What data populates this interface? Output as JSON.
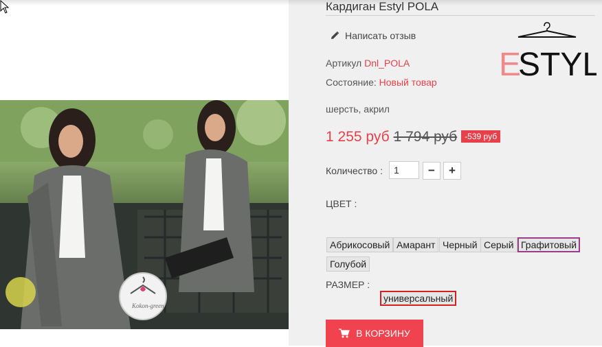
{
  "product": {
    "title": "Кардиган Estyl POLA",
    "review_link": "Написать отзыв",
    "sku_label": "Артикул",
    "sku_value": "Dnl_POLA",
    "condition_label": "Состояние:",
    "condition_value": "Новый товар",
    "material": "шерсть, акрил",
    "brand_logo_text": "ESTYL",
    "image_watermark": "Kokon-green"
  },
  "pricing": {
    "price": "1 255 руб",
    "old_price": "1 794 руб",
    "discount": "-539 руб"
  },
  "quantity": {
    "label": "Количество :",
    "value": "1",
    "minus": "−",
    "plus": "+"
  },
  "colors": {
    "label": "ЦВЕТ :",
    "options": [
      "Абрикосовый",
      "Амарант",
      "Черный",
      "Серый",
      "Графитовый",
      "Голубой"
    ],
    "selected": "Графитовый"
  },
  "sizes": {
    "label": "РАЗМЕР :",
    "options": [
      "универсальный"
    ],
    "selected": "универсальный"
  },
  "cart": {
    "label": "В КОРЗИНУ"
  },
  "theme": {
    "accent": "#e8404a",
    "cart_button": "#f0434f",
    "selected_color_border": "#9b3a8a",
    "selected_size_border": "#d42020",
    "panel_bg": "#f0f0f0"
  }
}
